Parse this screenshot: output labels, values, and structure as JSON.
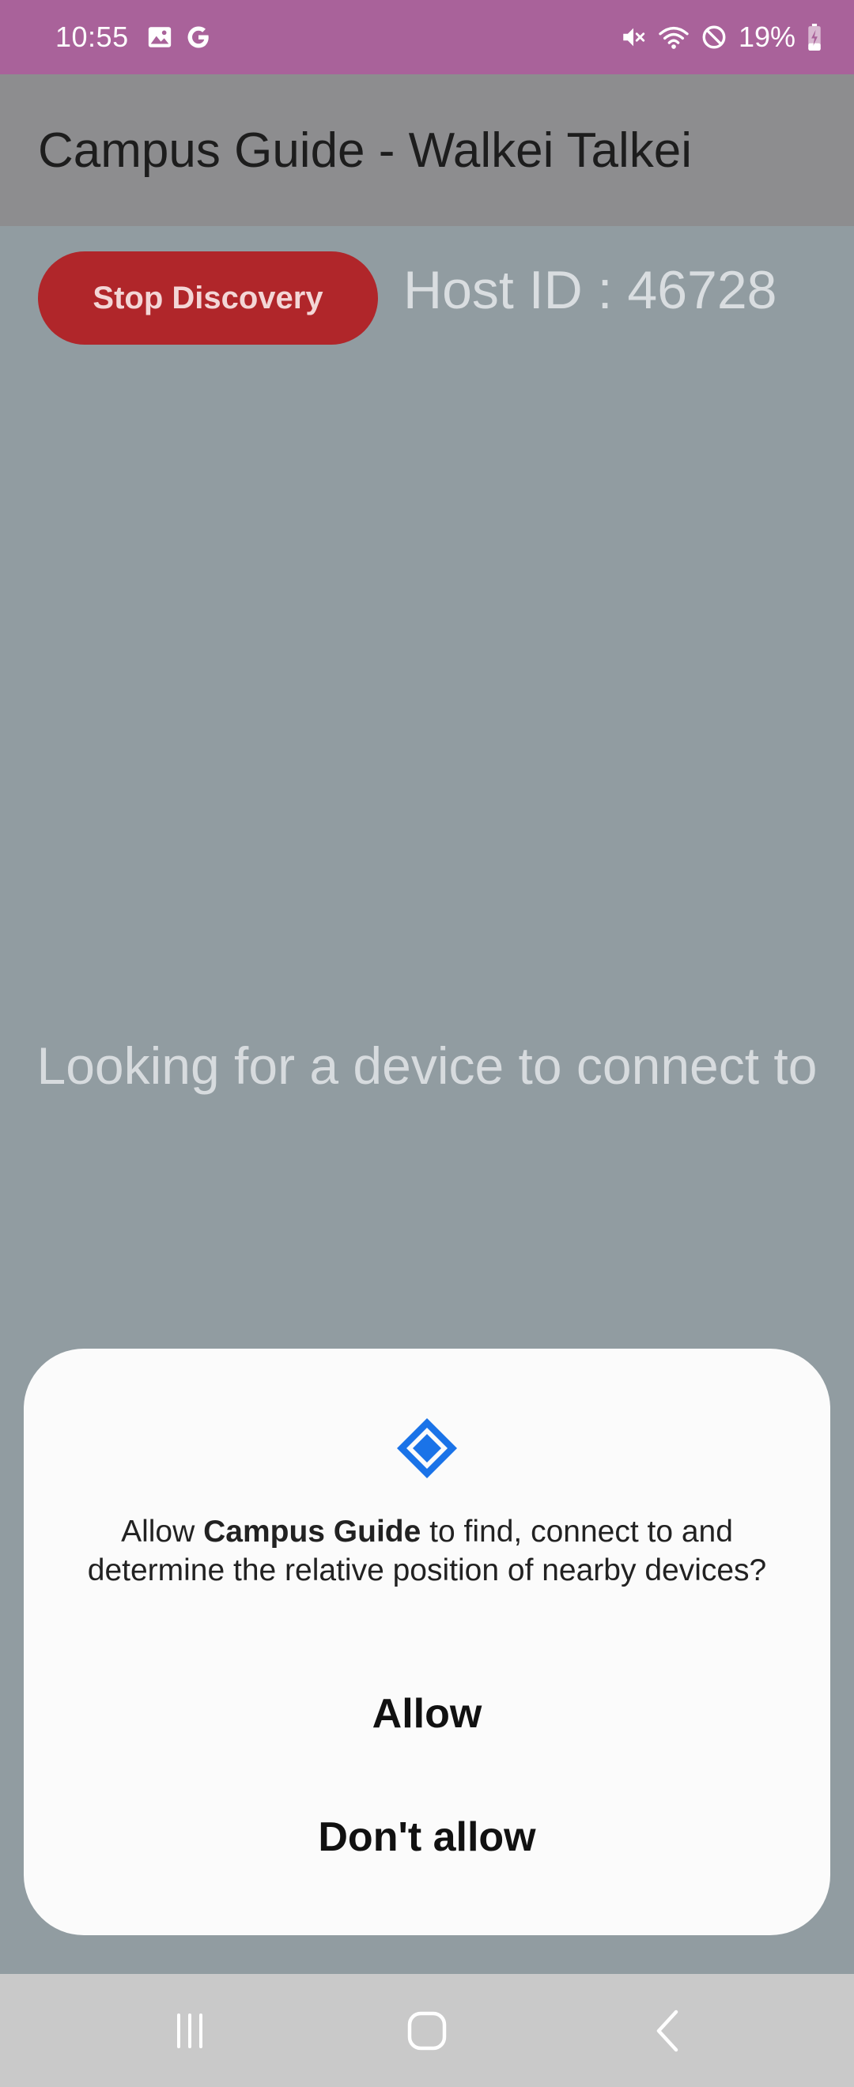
{
  "status_bar": {
    "time": "10:55",
    "left_icons": [
      "gallery-icon",
      "google-icon"
    ],
    "right_icons": [
      "mute-icon",
      "wifi-icon",
      "do-not-disturb-icon",
      "battery-charging-icon"
    ],
    "battery": "19%"
  },
  "app_bar": {
    "title": "Campus Guide - Walkei Talkei"
  },
  "content": {
    "stop_button_label": "Stop Discovery",
    "host_id": "Host ID : 46728",
    "status_message": "Looking for a device to connect to"
  },
  "dialog": {
    "icon": "nearby-devices-icon",
    "message_prefix": "Allow ",
    "app_name": "Campus Guide",
    "message_suffix": " to find, connect to and determine the relative position of nearby devices?",
    "allow_label": "Allow",
    "deny_label": "Don't allow"
  },
  "nav_bar": {
    "icons": [
      "recents-icon",
      "home-icon",
      "back-icon"
    ]
  },
  "colors": {
    "status_bar": "#a9629a",
    "app_bar": "#8d8d8f",
    "background": "#919ca1",
    "stop_button": "#b0262a",
    "dialog_icon": "#1a73e8"
  }
}
